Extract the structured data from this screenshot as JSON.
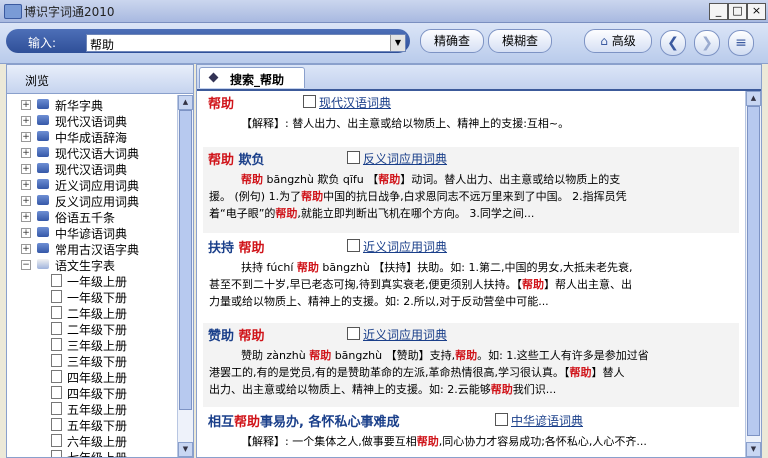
{
  "window": {
    "title": "博识字词通2010"
  },
  "window_controls": {
    "minimize": "_",
    "maximize": "□",
    "close": "×"
  },
  "toolbar": {
    "input_label": "输入:",
    "input_value": "帮助",
    "exact_search": "精确查",
    "fuzzy_search": "模糊查",
    "advanced": "高级"
  },
  "browse": {
    "title": "浏览",
    "dictionaries": [
      "新华字典",
      "现代汉语词典",
      "中华成语辞海",
      "现代汉语大词典",
      "现代汉语词典",
      "近义词应用词典",
      "反义词应用词典",
      "俗语五千条",
      "中华谚语词典",
      "常用古汉语字典"
    ],
    "expanded_title": "语文生字表",
    "children": [
      "一年级上册",
      "一年级下册",
      "二年级上册",
      "二年级下册",
      "三年级上册",
      "三年级下册",
      "四年级上册",
      "四年级下册",
      "五年级上册",
      "五年级下册",
      "六年级上册",
      "七年级上册"
    ]
  },
  "tab": {
    "label": "搜索_帮助"
  },
  "results": [
    {
      "headword": [
        "帮助"
      ],
      "source": "现代汉语词典",
      "lines": [
        [
          {
            "t": "【解释】: 替人出力、出主意或给以物质上、精神上的支援:互相~。"
          }
        ]
      ]
    },
    {
      "headword": [
        "帮助",
        " 欺负"
      ],
      "source": "反义词应用词典",
      "lines": [
        [
          {
            "t": "帮助",
            "h": 1
          },
          {
            "t": " bāngzhù 欺负 qīfu 【"
          },
          {
            "t": "帮助",
            "h": 1
          },
          {
            "t": "】动词。替人出力、出主意或给以物质上的支"
          }
        ],
        [
          {
            "t": "援。 (例句) 1.为了"
          },
          {
            "t": "帮助",
            "h": 1
          },
          {
            "t": "中国的抗日战争,白求恩同志不远万里来到了中国。 2.指挥员凭"
          }
        ],
        [
          {
            "t": "着“电子眼”的"
          },
          {
            "t": "帮助",
            "h": 1
          },
          {
            "t": ",就能立即判断出飞机在哪个方向。 3.同学之间..."
          }
        ]
      ]
    },
    {
      "headword": [
        "扶持",
        " 帮助"
      ],
      "source": "近义词应用词典",
      "lines": [
        [
          {
            "t": "扶持 fúchí "
          },
          {
            "t": "帮助",
            "h": 1
          },
          {
            "t": " bāngzhù 【扶持】扶助。如: 1.第二,中国的男女,大抵未老先衰,"
          }
        ],
        [
          {
            "t": "甚至不到二十岁,早已老态可掬,待到真实衰老,便更须别人扶持。【"
          },
          {
            "t": "帮助",
            "h": 1
          },
          {
            "t": "】帮人出主意、出"
          }
        ],
        [
          {
            "t": "力量或给以物质上、精神上的支援。如: 2.所以,对于反动营垒中可能..."
          }
        ]
      ]
    },
    {
      "headword": [
        "赞助",
        " 帮助"
      ],
      "source": "近义词应用词典",
      "lines": [
        [
          {
            "t": "赞助 zànzhù "
          },
          {
            "t": "帮助",
            "h": 1
          },
          {
            "t": " bāngzhù 【赞助】支持,"
          },
          {
            "t": "帮助",
            "h": 1
          },
          {
            "t": "。如: 1.这些工人有许多是参加过省"
          }
        ],
        [
          {
            "t": "港罢工的,有的是党员,有的是赞助革命的左派,革命热情很高,学习很认真。【"
          },
          {
            "t": "帮助",
            "h": 1
          },
          {
            "t": "】替人"
          }
        ],
        [
          {
            "t": "出力、出主意或给以物质上、精神上的支援。如: 2.云能够"
          },
          {
            "t": "帮助",
            "h": 1
          },
          {
            "t": "我们识..."
          }
        ]
      ]
    },
    {
      "headword": [
        "相互",
        "帮助",
        "事易办, 各怀私心事难成"
      ],
      "source": "中华谚语词典",
      "lines": [
        [
          {
            "t": "【解释】: 一个集体之人,做事要互相"
          },
          {
            "t": "帮助",
            "h": 1
          },
          {
            "t": ",同心协力才容易成功;各怀私心,人心不齐..."
          }
        ]
      ]
    }
  ]
}
